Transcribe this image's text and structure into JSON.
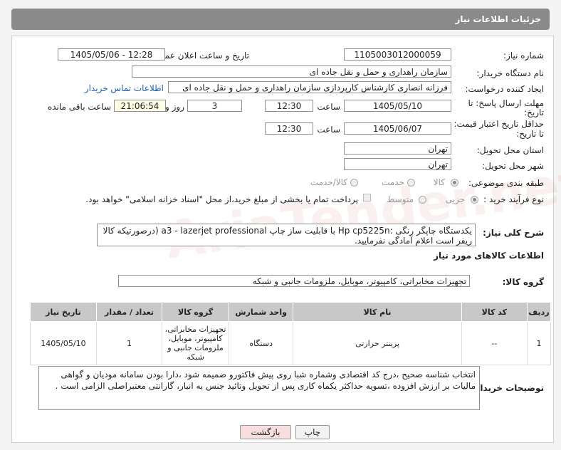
{
  "header": {
    "title": "جزئیات اطلاعات نیاز"
  },
  "form": {
    "need_number": {
      "label": "شماره نیاز:",
      "value": "1105003012000059"
    },
    "announce_datetime": {
      "label": "تاریخ و ساعت اعلان عمومی:",
      "value": "1405/05/06 - 12:28"
    },
    "buyer_org": {
      "label": "نام دستگاه خریدار:",
      "value": "سازمان راهداری و حمل و نقل جاده ای"
    },
    "requester": {
      "label": "ایجاد کننده درخواست:",
      "value": "فرزانه انصاری کارشناس کارپردازی سازمان راهداری و حمل و نقل جاده ای",
      "contact_link": "اطلاعات تماس خریدار"
    },
    "reply_deadline": {
      "label1": "مهلت ارسال پاسخ: تا",
      "label2": "تاریخ:",
      "date": "1405/05/10",
      "time_label": "ساعت",
      "time": "12:30",
      "days": "3",
      "days_label": "روز و",
      "remaining": "21:06:54",
      "remaining_label": "ساعت باقی مانده"
    },
    "price_validity": {
      "label1": "حداقل تاریخ اعتبار قیمت:",
      "label2": "تا تاریخ:",
      "date": "1405/06/07",
      "time_label": "ساعت",
      "time": "12:30"
    },
    "delivery_province": {
      "label": "استان محل تحویل:",
      "value": "تهران"
    },
    "delivery_city": {
      "label": "شهر محل تحویل:",
      "value": "تهران"
    },
    "category": {
      "label": "طبقه بندی موضوعی:",
      "options": [
        "کالا",
        "خدمت",
        "کالا/خدمت"
      ],
      "selected": "کالا"
    },
    "purchase_type": {
      "label": "نوع فرآیند خرید :",
      "options": [
        "جزیی",
        "متوسط"
      ],
      "selected": "جزیی",
      "note": "پرداخت تمام یا بخشی از مبلغ خرید،از محل \"اسناد خزانه اسلامی\" خواهد بود."
    },
    "description": {
      "label": "شرح کلی نیاز:",
      "value": "یکدستگاه چاپگر رنگی :Hp cp5225n   با قابلیت ساز چاپ a3 - lazerjet professional (درصورتیکه کالا ریفر است اعلام آمادگی نفرمایید."
    },
    "goods_info_title": "اطلاعات کالاهای مورد نیاز",
    "goods_group": {
      "label": "گروه کالا:",
      "value": "تجهیزات مخابراتی، کامپیوتر، موبایل، ملزومات جانبی و شبکه"
    }
  },
  "table": {
    "headers": [
      "ردیف",
      "کد کالا",
      "نام کالا",
      "واحد شمارش",
      "گروه کالا",
      "تعداد / مقدار",
      "تاریخ نیاز"
    ],
    "rows": [
      [
        "1",
        "--",
        "پرینتر حرارتی",
        "دستگاه",
        "تجهیزات مخابراتی، کامپیوتر، موبایل، ملزومات جانبی و شبکه",
        "1",
        "1405/05/10"
      ]
    ]
  },
  "buyer_notes": {
    "label": "توضیحات خریدار:",
    "value": "انتخاب شناسه صحیح ،درج کد اقتصادی وشماره شبا روی پیش فاکتورو ضمیمه شود ،دارا بودن سامانه مودیان و گواهی مالیات بر ارزش افزوده ،تسویه حداکثر یکماه کاری پس از تحویل وتائید جنس به انبار، گارانتی معتبراصلی الزامی است ."
  },
  "buttons": {
    "print": "چاپ",
    "back": "بازگشت"
  },
  "watermark": "AriaTender.net",
  "colors": {
    "titlebar": "#8a8a8a",
    "link": "#1a5fb4",
    "back_button": "#f8dede",
    "table_header": "#c8c8c8"
  }
}
